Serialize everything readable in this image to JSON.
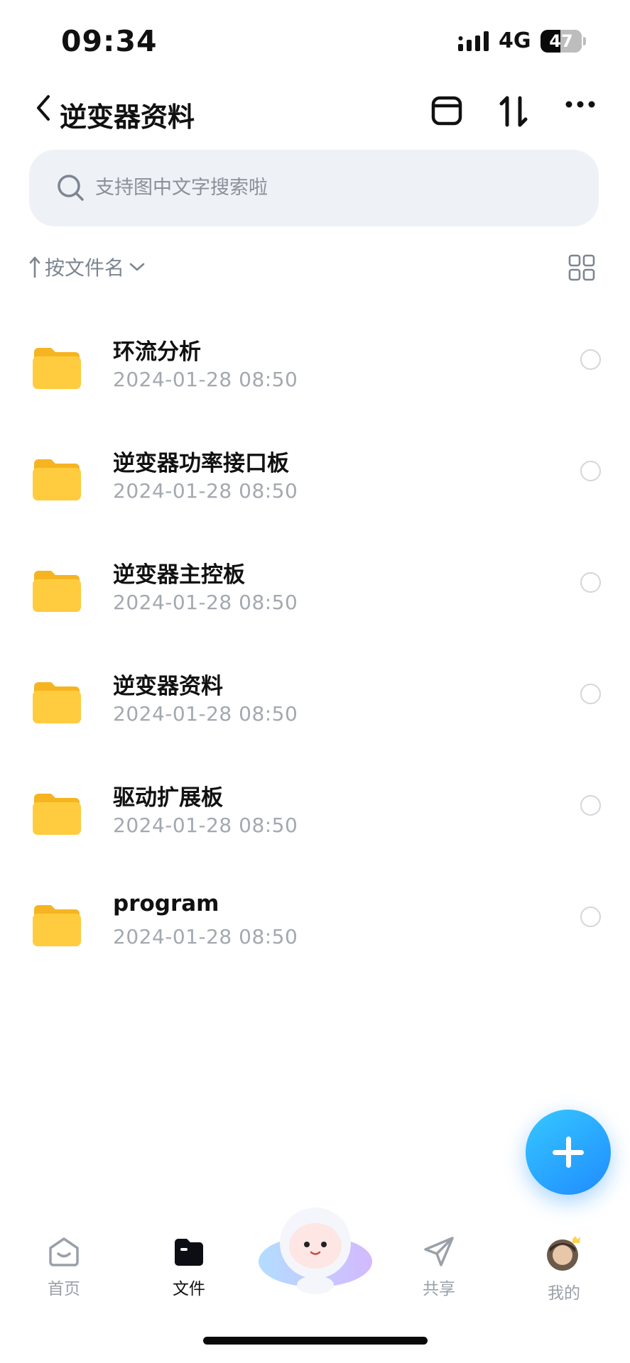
{
  "status_bar": {
    "time": "09:34",
    "network": "4G",
    "battery": "47"
  },
  "header": {
    "title": "逆变器资料"
  },
  "search": {
    "placeholder": "支持图中文字搜索啦"
  },
  "sort": {
    "label": "按文件名"
  },
  "files": [
    {
      "name": "环流分析",
      "date": "2024-01-28 08:50"
    },
    {
      "name": "逆变器功率接口板",
      "date": "2024-01-28 08:50"
    },
    {
      "name": "逆变器主控板",
      "date": "2024-01-28 08:50"
    },
    {
      "name": "逆变器资料",
      "date": "2024-01-28 08:50"
    },
    {
      "name": "驱动扩展板",
      "date": "2024-01-28 08:50"
    },
    {
      "name": "program",
      "date": "2024-01-28 08:50"
    }
  ],
  "tab_bar": {
    "home": "首页",
    "files": "文件",
    "share": "共享",
    "mine": "我的"
  },
  "icons": {
    "back": "chevron-left-icon",
    "box": "archive-icon",
    "sort": "sort-arrows-icon",
    "more": "more-icon",
    "view": "grid-view-icon",
    "add": "plus-icon"
  },
  "colors": {
    "accent": "#1f8bff",
    "folder": "#ffc83d",
    "search_bg": "#eef1f6"
  }
}
